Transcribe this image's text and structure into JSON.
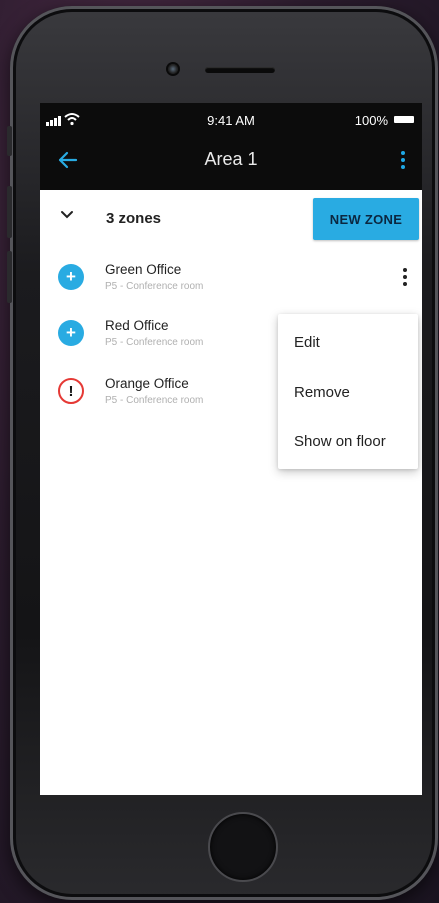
{
  "status": {
    "time": "9:41 AM",
    "battery": "100%"
  },
  "nav": {
    "title": "Area 1"
  },
  "zones": {
    "count_label": "3 zones",
    "new_button": "NEW ZONE"
  },
  "items": [
    {
      "name": "Green Office",
      "sub": "P5 - Conference room",
      "icon": "plus-icon"
    },
    {
      "name": "Red Office",
      "sub": "P5 - Conference room",
      "icon": "plus-icon"
    },
    {
      "name": "Orange Office",
      "sub": "P5 - Conference room",
      "icon": "warning-icon"
    }
  ],
  "menu": {
    "edit": "Edit",
    "remove": "Remove",
    "show_on_floor": "Show on floor"
  },
  "colors": {
    "accent": "#29abe2",
    "warning": "#e53935",
    "topbar": "#0c0c0c"
  }
}
